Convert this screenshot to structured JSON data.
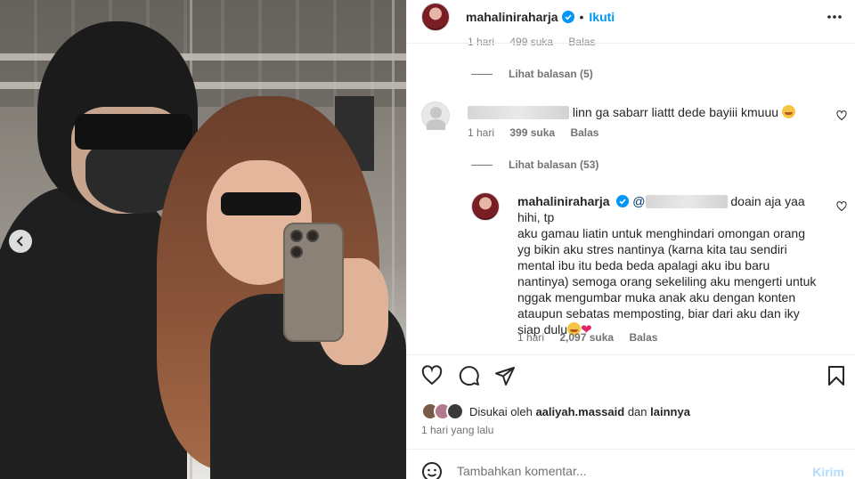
{
  "header": {
    "username": "mahalini raharja",
    "username_display": "mahaliniraharja",
    "separator": "•",
    "follow_label": "Ikuti"
  },
  "partial_comment": {
    "time": "1 hari",
    "likes": "499 suka",
    "reply": "Balas"
  },
  "replies": [
    {
      "label": "Lihat balasan (5)"
    },
    {
      "label": "Lihat balasan (53)"
    }
  ],
  "comment1": {
    "text": " linn ga sabarr liattt dede bayiii kmuuu",
    "time": "1 hari",
    "likes": "399 suka",
    "reply": "Balas"
  },
  "comment2": {
    "username": "mahaliniraharja",
    "mention_prefix": "@",
    "line1_tail": "doain aja yaa hihi, tp",
    "line2": "aku gamau liatin untuk menghindari omongan orang",
    "line3": "yg bikin aku stres nantinya (karna kita tau sendiri",
    "line4": "mental ibu itu beda beda apalagi aku ibu baru",
    "line5": "nantinya) semoga orang sekeliling aku mengerti untuk",
    "line6": "nggak mengumbar muka anak aku dengan konten",
    "line7": "ataupun sebatas memposting, biar dari aku dan iky",
    "line8": "siap dulu",
    "time": "1 hari",
    "likes": "2,097 suka",
    "reply": "Balas"
  },
  "likes": {
    "prefix": "Disukai oleh",
    "user": "aaliyah.massaid",
    "middle": "dan",
    "suffix": "lainnya"
  },
  "timestamp": "1 hari yang lalu",
  "composer": {
    "placeholder": "Tambahkan komentar...",
    "send_label": "Kirim"
  },
  "colors": {
    "accent": "#0095f6",
    "send_disabled": "#b3dbff",
    "muted": "#737373",
    "text": "#262626"
  },
  "icons": [
    "verified-icon",
    "more-icon",
    "heart-icon",
    "comment-icon",
    "share-icon",
    "bookmark-icon",
    "emoji-icon",
    "chevron-left-icon"
  ]
}
